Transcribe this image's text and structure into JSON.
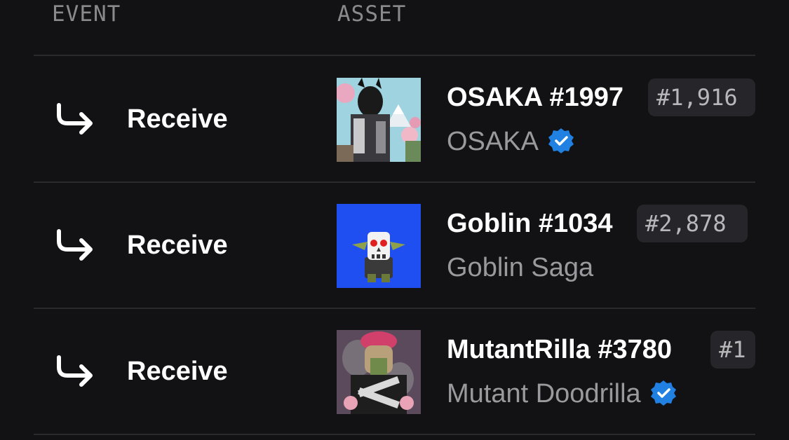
{
  "header": {
    "event_label": "EVENT",
    "asset_label": "ASSET"
  },
  "rows": [
    {
      "event": {
        "label": "Receive",
        "icon": "receive-arrow-icon"
      },
      "asset": {
        "name": "OSAKA #1997",
        "rank": "#1,916",
        "collection": "OSAKA",
        "verified": true
      }
    },
    {
      "event": {
        "label": "Receive",
        "icon": "receive-arrow-icon"
      },
      "asset": {
        "name": "Goblin #1034",
        "rank": "#2,878",
        "collection": "Goblin Saga",
        "verified": false
      }
    },
    {
      "event": {
        "label": "Receive",
        "icon": "receive-arrow-icon"
      },
      "asset": {
        "name": "MutantRilla #3780",
        "rank": "#1",
        "collection": "Mutant Doodrilla",
        "verified": true
      }
    }
  ],
  "colors": {
    "background": "#121214",
    "divider": "#2a2a2d",
    "header_text": "#8a8a8d",
    "primary_text": "#ffffff",
    "secondary_text": "#9a9a9e",
    "badge_bg": "#26262a",
    "verified_blue": "#2081e2",
    "goblin_bg": "#1f4ff0"
  }
}
